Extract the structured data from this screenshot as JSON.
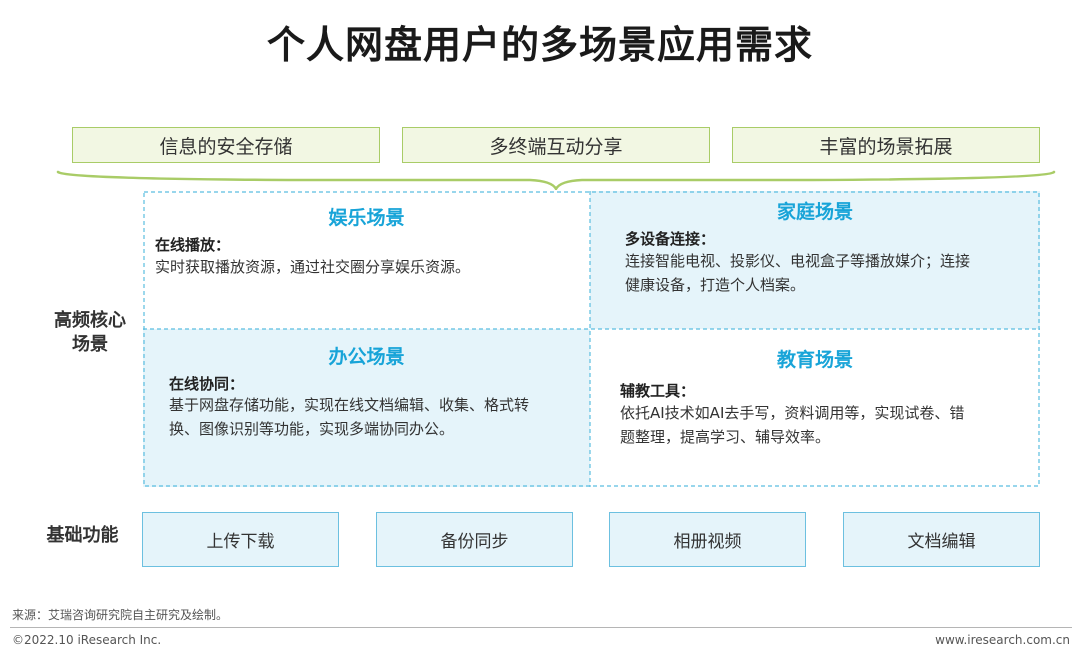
{
  "title": "个人网盘用户的多场景应用需求",
  "needs": [
    "信息的安全存储",
    "多终端互动分享",
    "丰富的场景拓展"
  ],
  "core": {
    "label_line1": "高频核心",
    "label_line2": "场景",
    "quadrants": [
      {
        "title": "娱乐场景",
        "subtitle": "在线播放：",
        "lines": [
          "实时获取播放资源，通过社交圈分享娱乐资源。"
        ]
      },
      {
        "title": "家庭场景",
        "subtitle": "多设备连接：",
        "lines": [
          "连接智能电视、投影仪、电视盒子等播放媒介；连接",
          "健康设备，打造个人档案。"
        ]
      },
      {
        "title": "办公场景",
        "subtitle": "在线协同：",
        "lines": [
          "基于网盘存储功能，实现在线文档编辑、收集、格式转",
          "换、图像识别等功能，实现多端协同办公。"
        ]
      },
      {
        "title": "教育场景",
        "subtitle": "辅教工具：",
        "lines": [
          "依托AI技术如AI去手写，资料调用等，实现试卷、错",
          "题整理，提高学习、辅导效率。"
        ]
      }
    ]
  },
  "basic": {
    "label": "基础功能",
    "items": [
      "上传下载",
      "备份同步",
      "相册视频",
      "文档编辑"
    ]
  },
  "footer": {
    "source": "来源：艾瑞咨询研究院自主研究及绘制。",
    "copyright": "©2022.10 iResearch Inc.",
    "website": "www.iresearch.com.cn"
  },
  "colors": {
    "accent_blue": "#18a4d8",
    "light_blue_fill": "#e5f4fa",
    "green_border": "#a9cc67",
    "green_fill": "#f2f7e3"
  }
}
